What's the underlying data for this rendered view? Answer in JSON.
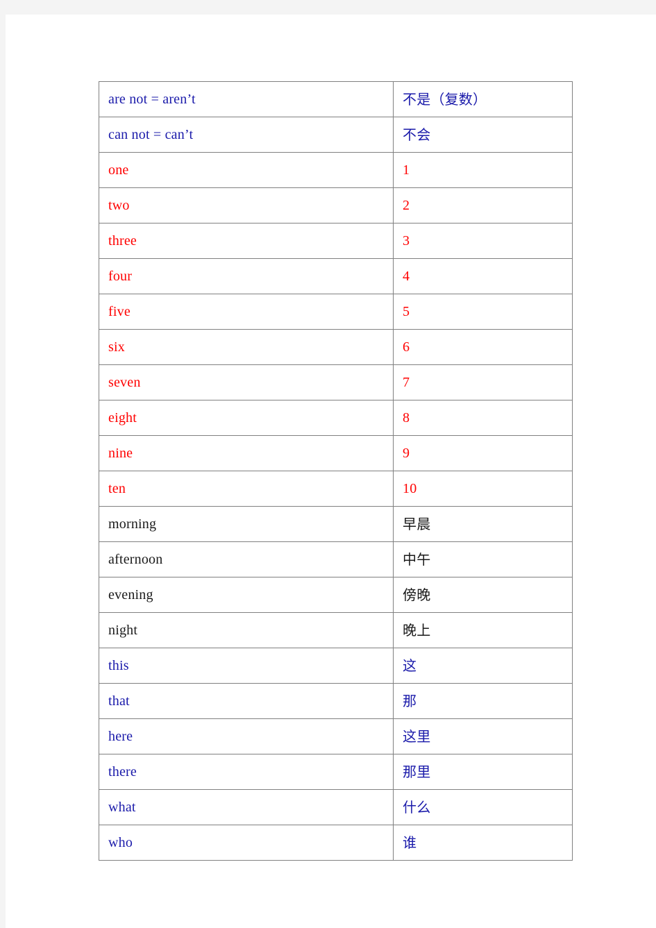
{
  "document": {
    "page_background": "#ffffff",
    "canvas_background": "#f4f4f4",
    "colors": {
      "blue": "#1a1aaa",
      "red": "#ff0000",
      "black": "#1a1a1a",
      "border": "#808080"
    }
  },
  "table": {
    "columns": 2,
    "row_count": 22,
    "rows": [
      {
        "term": "are  not  =  aren’t",
        "meaning": "不是（复数）",
        "color": "blue",
        "meaning_is_cjk": true
      },
      {
        "term": "can  not  =  can’t",
        "meaning": "不会",
        "color": "blue",
        "meaning_is_cjk": true
      },
      {
        "term": "one",
        "meaning": "1",
        "color": "red",
        "meaning_is_cjk": false
      },
      {
        "term": "two",
        "meaning": "2",
        "color": "red",
        "meaning_is_cjk": false
      },
      {
        "term": "three",
        "meaning": "3",
        "color": "red",
        "meaning_is_cjk": false
      },
      {
        "term": "four",
        "meaning": "4",
        "color": "red",
        "meaning_is_cjk": false
      },
      {
        "term": "five",
        "meaning": "5",
        "color": "red",
        "meaning_is_cjk": false
      },
      {
        "term": "six",
        "meaning": "6",
        "color": "red",
        "meaning_is_cjk": false
      },
      {
        "term": "seven",
        "meaning": "7",
        "color": "red",
        "meaning_is_cjk": false
      },
      {
        "term": "eight",
        "meaning": "8",
        "color": "red",
        "meaning_is_cjk": false
      },
      {
        "term": "nine",
        "meaning": "9",
        "color": "red",
        "meaning_is_cjk": false
      },
      {
        "term": "ten",
        "meaning": "10",
        "color": "red",
        "meaning_is_cjk": false
      },
      {
        "term": "morning",
        "meaning": "早晨",
        "color": "black",
        "meaning_is_cjk": true
      },
      {
        "term": "afternoon",
        "meaning": "中午",
        "color": "black",
        "meaning_is_cjk": true
      },
      {
        "term": "evening",
        "meaning": "傍晚",
        "color": "black",
        "meaning_is_cjk": true
      },
      {
        "term": "night",
        "meaning": "晚上",
        "color": "black",
        "meaning_is_cjk": true
      },
      {
        "term": "this",
        "meaning": "这",
        "color": "blue",
        "meaning_is_cjk": true
      },
      {
        "term": "that",
        "meaning": "那",
        "color": "blue",
        "meaning_is_cjk": true
      },
      {
        "term": "here",
        "meaning": "这里",
        "color": "blue",
        "meaning_is_cjk": true
      },
      {
        "term": "there",
        "meaning": "那里",
        "color": "blue",
        "meaning_is_cjk": true
      },
      {
        "term": "what",
        "meaning": "什么",
        "color": "blue",
        "meaning_is_cjk": true
      },
      {
        "term": "who",
        "meaning": "谁",
        "color": "blue",
        "meaning_is_cjk": true
      }
    ]
  }
}
